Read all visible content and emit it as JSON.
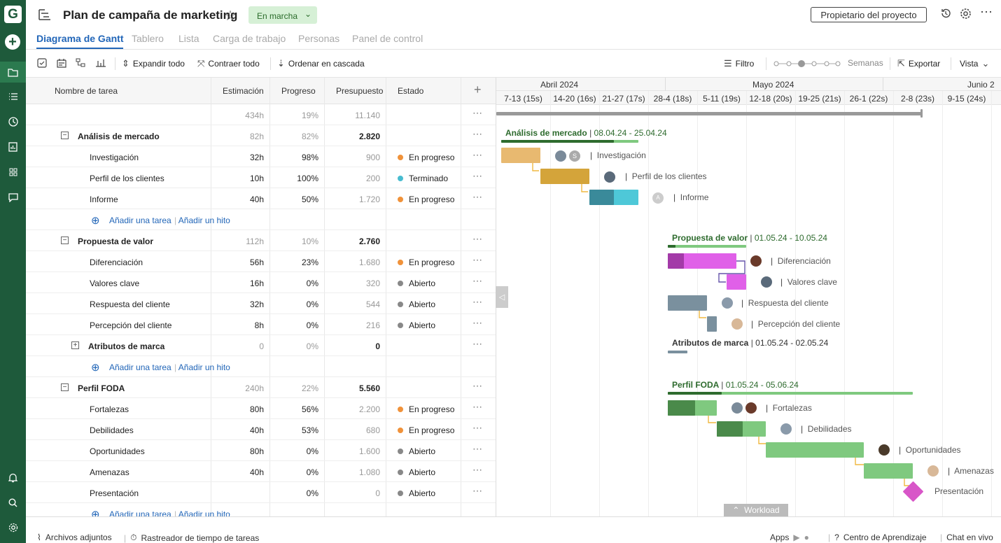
{
  "colors": {
    "brand": "#1e5a3b",
    "accent": "#2266b8",
    "status_orange": "#f0923a",
    "status_cyan": "#48bcd0",
    "status_gray": "#888888"
  },
  "header": {
    "title": "Plan de campaña de marketing",
    "status": "En marcha",
    "owner_button": "Propietario del proyecto"
  },
  "tabs": [
    "Diagrama de Gantt",
    "Tablero",
    "Lista",
    "Carga de trabajo",
    "Personas",
    "Panel de control"
  ],
  "toolbar": {
    "expand": "Expandir todo",
    "collapse": "Contraer todo",
    "cascade": "Ordenar en cascada",
    "filter": "Filtro",
    "zoom": "Semanas",
    "export": "Exportar",
    "view": "Vista"
  },
  "columns": {
    "task": "Nombre de tarea",
    "estimate": "Estimación",
    "progress": "Progreso",
    "budget": "Presupuesto",
    "status": "Estado"
  },
  "totals": {
    "estimate": "434h",
    "progress": "19%",
    "budget": "11.140"
  },
  "rows": [
    {
      "name": "Análisis de mercado",
      "estimate": "82h",
      "progress": "82%",
      "budget": "2.820"
    },
    {
      "name": "Investigación",
      "estimate": "32h",
      "progress": "98%",
      "budget": "900",
      "status": "En progreso"
    },
    {
      "name": "Perfil de los clientes",
      "estimate": "10h",
      "progress": "100%",
      "budget": "200",
      "status": "Terminado"
    },
    {
      "name": "Informe",
      "estimate": "40h",
      "progress": "50%",
      "budget": "1.720",
      "status": "En progreso"
    },
    {
      "name": "Propuesta de valor",
      "estimate": "112h",
      "progress": "10%",
      "budget": "2.760"
    },
    {
      "name": "Diferenciación",
      "estimate": "56h",
      "progress": "23%",
      "budget": "1.680",
      "status": "En progreso"
    },
    {
      "name": "Valores clave",
      "estimate": "16h",
      "progress": "0%",
      "budget": "320",
      "status": "Abierto"
    },
    {
      "name": "Respuesta del cliente",
      "estimate": "32h",
      "progress": "0%",
      "budget": "544",
      "status": "Abierto"
    },
    {
      "name": "Percepción del cliente",
      "estimate": "8h",
      "progress": "0%",
      "budget": "216",
      "status": "Abierto"
    },
    {
      "name": "Atributos de marca",
      "estimate": "0",
      "progress": "0%",
      "budget": "0"
    },
    {
      "name": "Perfil FODA",
      "estimate": "240h",
      "progress": "22%",
      "budget": "5.560"
    },
    {
      "name": "Fortalezas",
      "estimate": "80h",
      "progress": "56%",
      "budget": "2.200",
      "status": "En progreso"
    },
    {
      "name": "Debilidades",
      "estimate": "40h",
      "progress": "53%",
      "budget": "680",
      "status": "En progreso"
    },
    {
      "name": "Oportunidades",
      "estimate": "80h",
      "progress": "0%",
      "budget": "1.600",
      "status": "Abierto"
    },
    {
      "name": "Amenazas",
      "estimate": "40h",
      "progress": "0%",
      "budget": "1.080",
      "status": "Abierto"
    },
    {
      "name": "Presentación",
      "estimate": "",
      "progress": "0%",
      "budget": "0",
      "status": "Abierto"
    }
  ],
  "add_task": "Añadir una tarea",
  "add_milestone": "Añadir un hito",
  "timeline": {
    "months": [
      "Abril 2024",
      "Mayo 2024",
      "Junio 2"
    ],
    "weeks": [
      "7-13 (15s)",
      "14-20 (16s)",
      "21-27 (17s)",
      "28-4 (18s)",
      "5-11 (19s)",
      "12-18 (20s)",
      "19-25 (21s)",
      "26-1 (22s)",
      "2-8 (23s)",
      "9-15 (24s)"
    ]
  },
  "gantt": {
    "g1": "Análisis de mercado",
    "g1_dates": "08.04.24 - 25.04.24",
    "g2": "Propuesta de valor",
    "g2_dates": "01.05.24 - 10.05.24",
    "g3": "Atributos de marca",
    "g3_dates": "01.05.24 - 02.05.24",
    "g4": "Perfil FODA",
    "g4_dates": "01.05.24 - 05.06.24",
    "av_s": "S",
    "av_a": "A",
    "workload": "Workload"
  },
  "footer": {
    "attachments": "Archivos adjuntos",
    "tracker": "Rastreador de tiempo de tareas",
    "apps": "Apps",
    "learning": "Centro de Aprendizaje",
    "chat": "Chat en vivo"
  }
}
